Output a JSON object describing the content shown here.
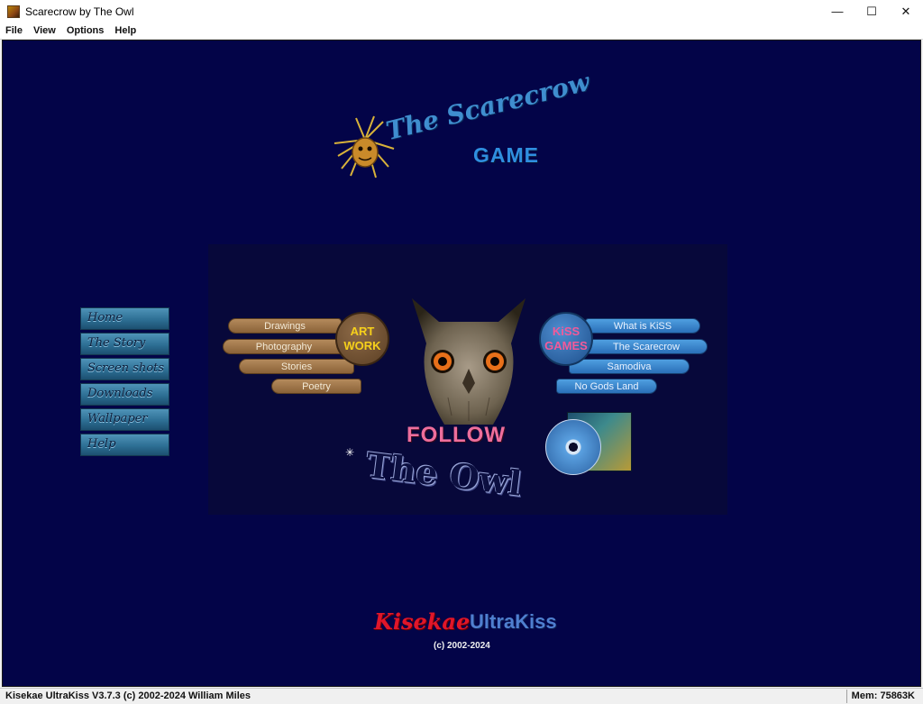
{
  "window": {
    "title": "Scarecrow by The Owl",
    "controls": {
      "minimize": "—",
      "maximize": "☐",
      "close": "✕"
    }
  },
  "menu": [
    "File",
    "View",
    "Options",
    "Help"
  ],
  "logo": {
    "title": "The Scarecrow",
    "subtitle": "GAME"
  },
  "side_nav": [
    "Home",
    "The Story",
    "Screen shots",
    "Downloads",
    "Wallpaper",
    "Help"
  ],
  "art_menu": {
    "bubble_line1": "ART",
    "bubble_line2": "WORK",
    "items": [
      "Drawings",
      "Photography",
      "Stories",
      "Poetry"
    ]
  },
  "kiss_menu": {
    "bubble_line1": "KiSS",
    "bubble_line2": "GAMES",
    "items": [
      "What is KiSS",
      "The Scarecrow",
      "Samodiva",
      "No Gods Land"
    ]
  },
  "banner": {
    "line1": "FOLLOW",
    "line2": "The Owl"
  },
  "footer": {
    "brand1": "Kisekae",
    "brand2": "UltraKiss",
    "copyright": "(c) 2002-2024"
  },
  "status": {
    "left": "Kisekae UltraKiss V3.7.3 (c) 2002-2024 William Miles",
    "right": "Mem: 75863K"
  },
  "colors": {
    "stage_bg": "#030448",
    "art_accent": "#f6d01b",
    "kiss_accent": "#f35a9a"
  }
}
